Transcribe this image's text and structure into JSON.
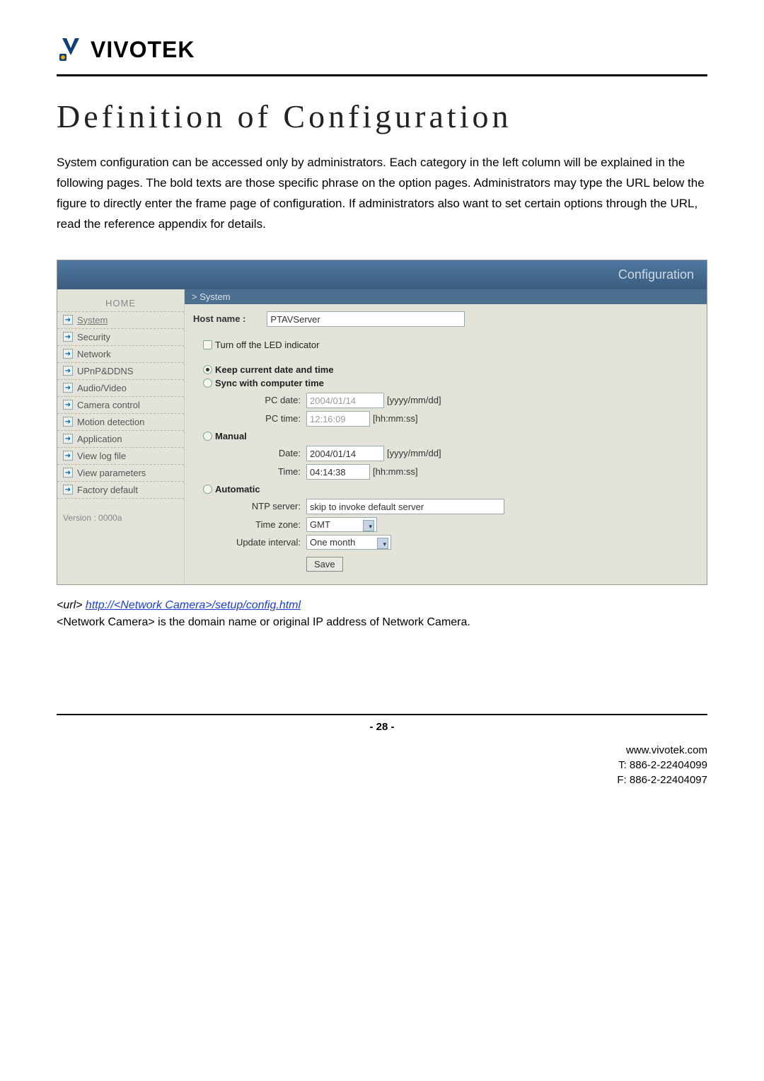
{
  "brand": {
    "name": "VIVOTEK"
  },
  "title": "Definition of Configuration",
  "intro": "System configuration can be accessed only by administrators. Each category in the left column will be explained in the following pages. The bold texts are those specific phrase on the option pages. Administrators may type the URL below the figure to directly enter the frame page of configuration. If administrators also want to set certain options through the URL, read the reference appendix for details.",
  "shot": {
    "header": "Configuration",
    "sidebar": {
      "home": "HOME",
      "items": [
        "System",
        "Security",
        "Network",
        "UPnP&DDNS",
        "Audio/Video",
        "Camera control",
        "Motion detection",
        "Application",
        "View log file",
        "View parameters",
        "Factory default"
      ],
      "version": "Version : 0000a"
    },
    "crumb": "> System",
    "host": {
      "label": "Host name :",
      "value": "PTAVServer"
    },
    "led": {
      "label": "Turn off the LED indicator"
    },
    "opt_keep": "Keep current date and time",
    "opt_sync": "Sync with computer time",
    "pcdate": {
      "label": "PC date:",
      "value": "2004/01/14",
      "hint": "[yyyy/mm/dd]"
    },
    "pctime": {
      "label": "PC time:",
      "value": "12:16:09",
      "hint": "[hh:mm:ss]"
    },
    "opt_manual": "Manual",
    "mdate": {
      "label": "Date:",
      "value": "2004/01/14",
      "hint": "[yyyy/mm/dd]"
    },
    "mtime": {
      "label": "Time:",
      "value": "04:14:38",
      "hint": "[hh:mm:ss]"
    },
    "opt_auto": "Automatic",
    "ntp": {
      "label": "NTP server:",
      "value": "skip to invoke default server"
    },
    "tz": {
      "label": "Time zone:",
      "value": "GMT"
    },
    "upd": {
      "label": "Update interval:",
      "value": "One month"
    },
    "save": "Save"
  },
  "url": {
    "prefix": "<url>  ",
    "link": "http://<Network Camera>/setup/config.html",
    "note": "<Network Camera> is the domain name or original IP address of Network Camera."
  },
  "page": "- 28 -",
  "footer": {
    "site": "www.vivotek.com",
    "tel": "T: 886-2-22404099",
    "fax": "F: 886-2-22404097"
  }
}
